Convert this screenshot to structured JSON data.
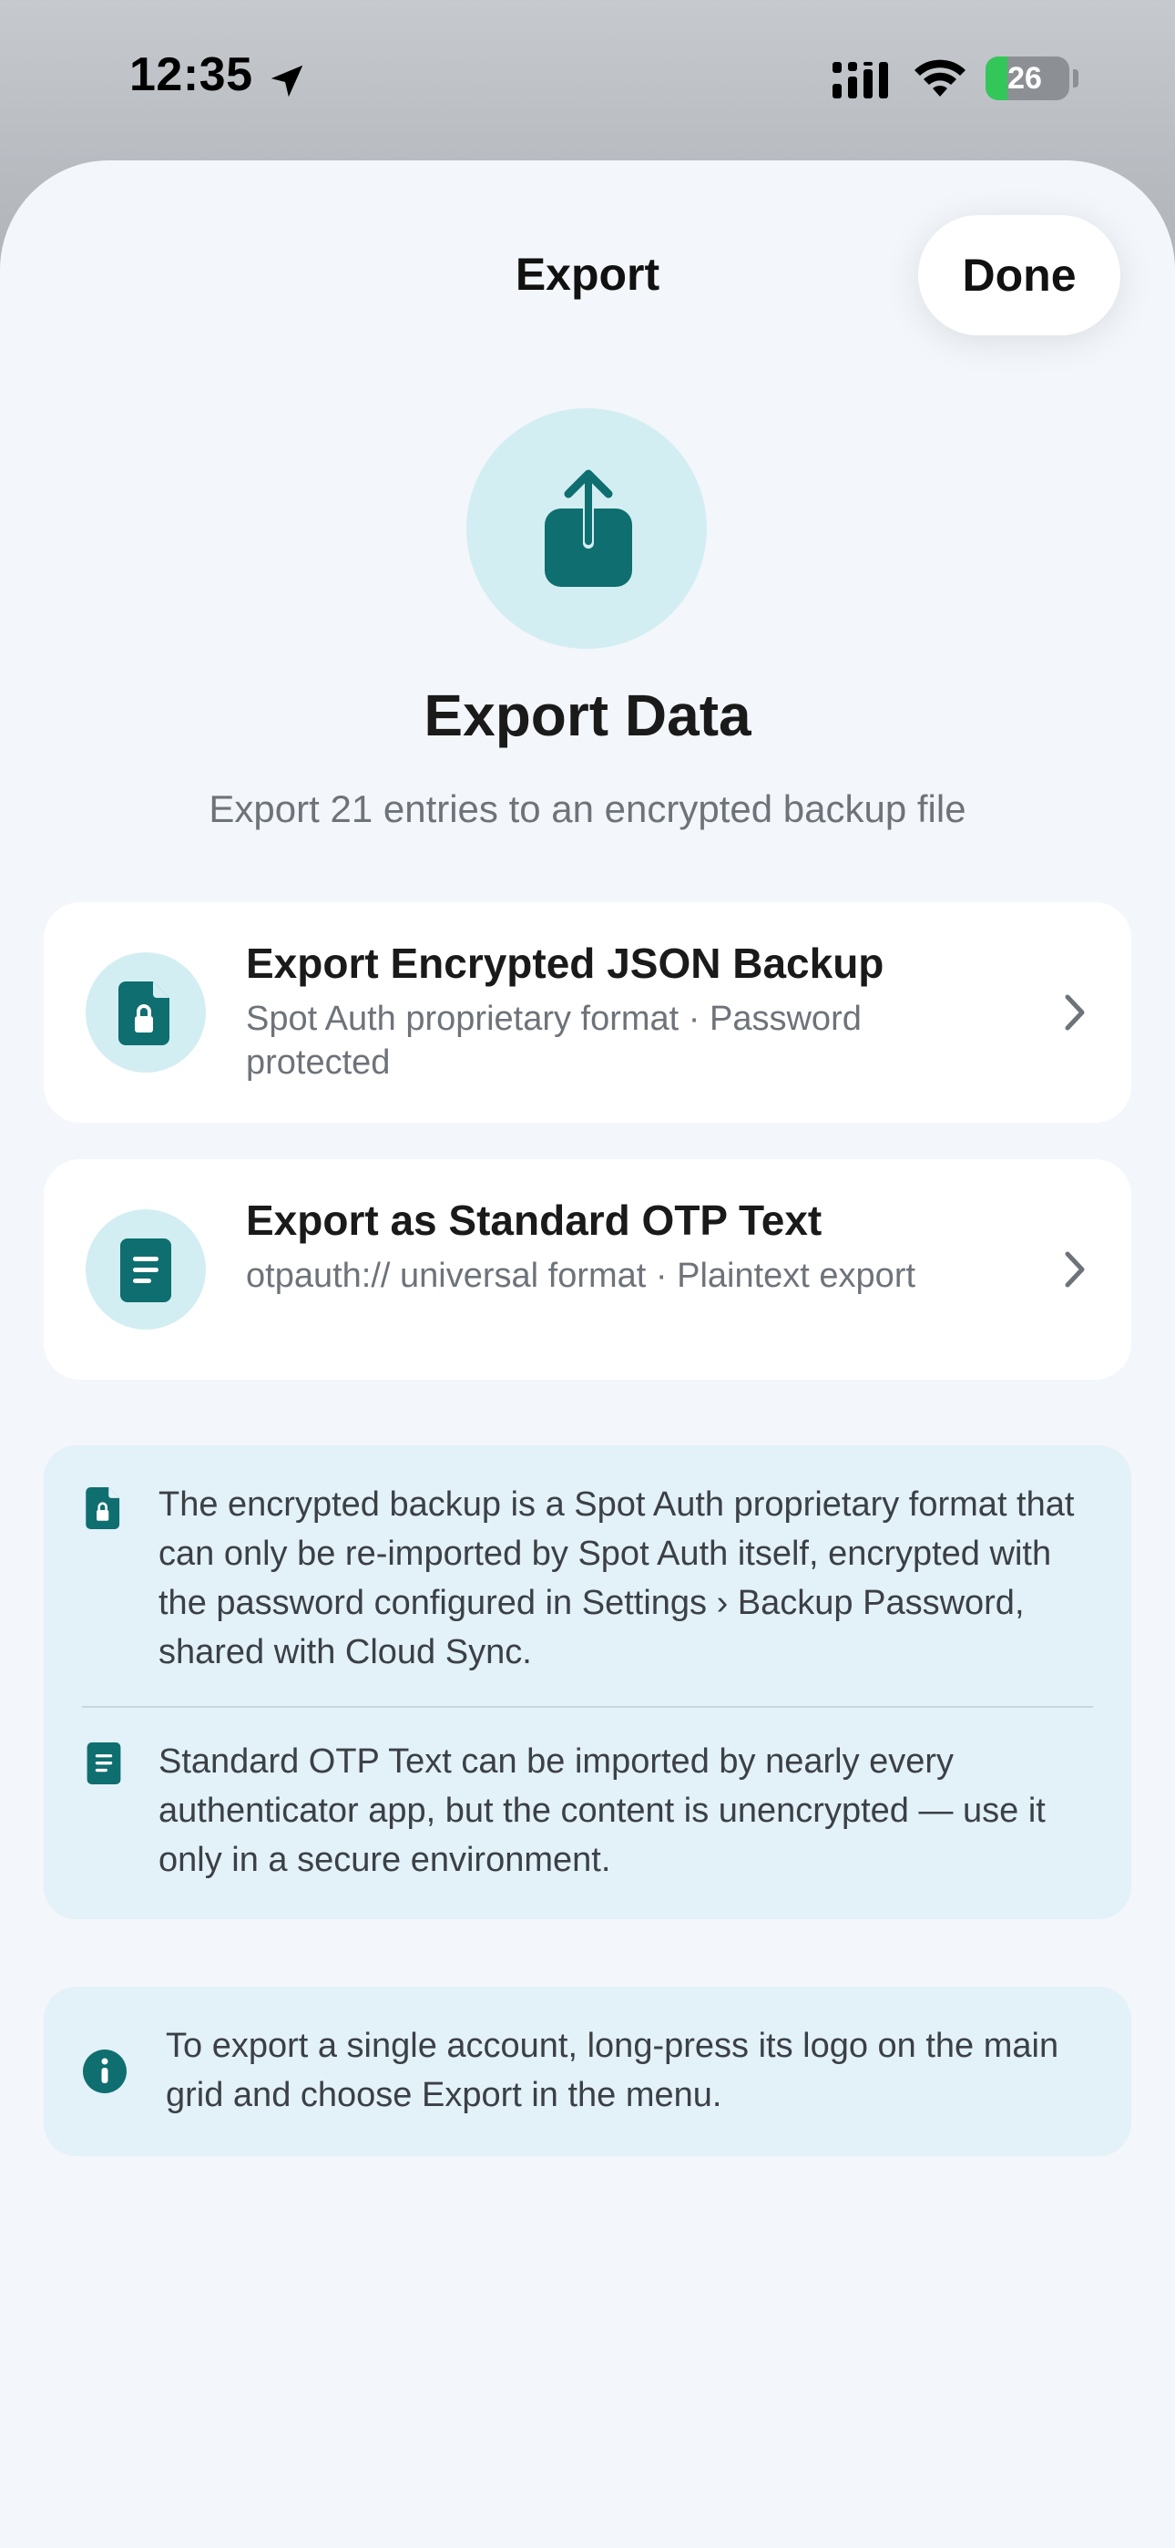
{
  "status_bar": {
    "time": "12:35",
    "battery": "26",
    "battery_level": 0.26,
    "icons": [
      "location-arrow-icon",
      "signal-icon",
      "wifi-icon",
      "battery-charging-icon"
    ]
  },
  "nav": {
    "title": "Export",
    "done_label": "Done"
  },
  "hero": {
    "icon": "share-export-icon",
    "title": "Export Data",
    "subtitle": "Export 21 entries to an encrypted backup file"
  },
  "options": [
    {
      "icon": "locked-document-icon",
      "title": "Export Encrypted JSON Backup",
      "description": "Spot Auth proprietary format · Password protected"
    },
    {
      "icon": "text-document-icon",
      "title": "Export as Standard OTP Text",
      "description": "otpauth:// universal format · Plaintext export"
    }
  ],
  "notes": [
    {
      "icon": "locked-document-icon",
      "text": "The encrypted backup is a Spot Auth proprietary format that can only be re-imported by Spot Auth itself, encrypted with the password configured in Settings › Backup Password, shared with Cloud Sync."
    },
    {
      "icon": "text-document-icon",
      "text": "Standard OTP Text can be imported by nearly every authenticator app, but the content is unencrypted — use it only in a secure environment."
    }
  ],
  "tip": {
    "icon": "info-icon",
    "text": "To export a single account, long-press its logo on the main grid and choose Export in the menu."
  },
  "colors": {
    "accent": "#0f6e6f",
    "icon_circle_bg": "#d3eef2",
    "sheet_bg": "#f3f6fa",
    "info_bg": "#e3f1f8"
  }
}
